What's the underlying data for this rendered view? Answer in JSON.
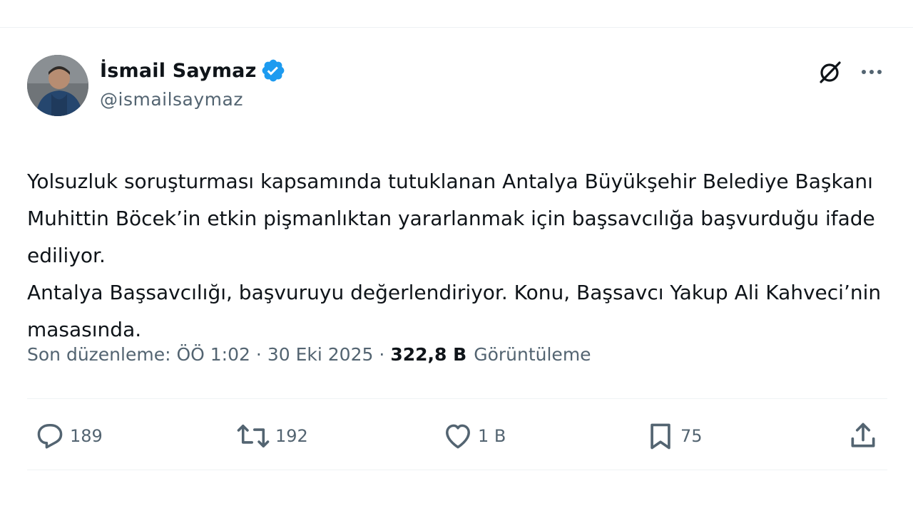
{
  "author": {
    "display_name": "İsmail Saymaz",
    "handle": "@ismailsaymaz",
    "verified_icon": "verified-badge-icon",
    "avatar_icon": "avatar"
  },
  "tweet": {
    "paragraphs": [
      "Yolsuzluk soruşturması kapsamında tutuklanan Antalya Büyükşehir Belediye Başkanı Muhittin Böcek’in etkin pişmanlıktan yararlanmak için başsavcılığa başvurduğu ifade ediliyor.",
      "Antalya Başsavcılığı, başvuruyu değerlendiriyor. Konu, Başsavcı Yakup Ali Kahveci’nin masasında."
    ]
  },
  "meta": {
    "edited_label": "Son düzenleme: ÖÖ 1:02",
    "separator": "·",
    "date": "30 Eki 2025",
    "views_count": "322,8 B",
    "views_label": "Görüntüleme"
  },
  "actions": {
    "reply_count": "189",
    "repost_count": "192",
    "like_count": "1 B",
    "bookmark_count": "75"
  },
  "icons": {
    "grok": "grok-icon",
    "more": "more-icon",
    "reply": "reply-icon",
    "repost": "repost-icon",
    "like": "heart-icon",
    "bookmark": "bookmark-icon",
    "share": "share-icon"
  },
  "colors": {
    "text": "#0f1419",
    "secondary": "#536471",
    "verified": "#1d9bf0",
    "divider": "#eff3f4"
  }
}
